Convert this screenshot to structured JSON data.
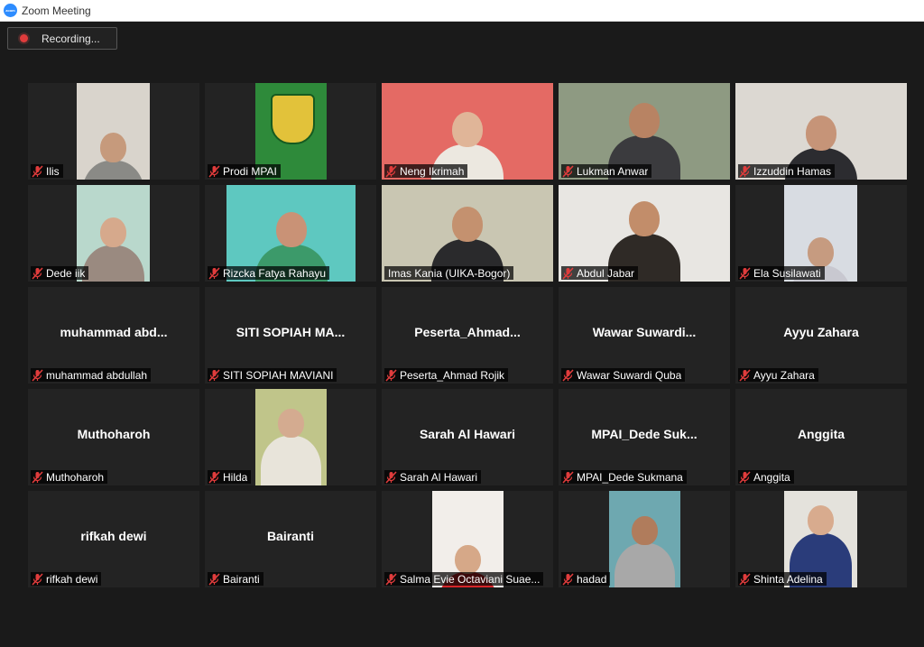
{
  "window": {
    "title": "Zoom Meeting"
  },
  "recording": {
    "label": "Recording..."
  },
  "colors": {
    "accent": "#2d8cff",
    "active_speaker": "#d8e24a",
    "muted": "#e03c3c"
  },
  "participants": [
    {
      "name": "Ilis",
      "muted": true,
      "video": true
    },
    {
      "name": "Prodi MPAI",
      "muted": true,
      "video": true
    },
    {
      "name": "Neng Ikrimah",
      "muted": true,
      "video": true
    },
    {
      "name": "Lukman Anwar",
      "muted": true,
      "video": true
    },
    {
      "name": "Izzuddin Hamas",
      "muted": true,
      "video": true
    },
    {
      "name": "Dede iik",
      "muted": true,
      "video": true
    },
    {
      "name": "Rizcka Fatya Rahayu",
      "muted": true,
      "video": true
    },
    {
      "name": "Imas Kania (UIKA-Bogor)",
      "muted": false,
      "video": true,
      "active_speaker": true
    },
    {
      "name": "Abdul Jabar",
      "muted": true,
      "video": true
    },
    {
      "name": "Ela Susilawati",
      "muted": true,
      "video": true
    },
    {
      "name": "muhammad abdullah",
      "display": "muhammad  abd...",
      "muted": true,
      "video": false
    },
    {
      "name": "SITI SOPIAH MAVIANI",
      "display": "SITI  SOPIAH  MA...",
      "muted": true,
      "video": false
    },
    {
      "name": "Peserta_Ahmad Rojik",
      "display": "Peserta_Ahmad...",
      "muted": true,
      "video": false
    },
    {
      "name": "Wawar Suwardi Quba",
      "display": "Wawar  Suwardi...",
      "muted": true,
      "video": false
    },
    {
      "name": "Ayyu Zahara",
      "display": "Ayyu Zahara",
      "muted": true,
      "video": false
    },
    {
      "name": "Muthoharoh",
      "display": "Muthoharoh",
      "muted": true,
      "video": false
    },
    {
      "name": "Hilda",
      "muted": true,
      "video": true
    },
    {
      "name": "Sarah Al Hawari",
      "display": "Sarah Al Hawari",
      "muted": true,
      "video": false
    },
    {
      "name": "MPAI_Dede Sukmana",
      "display": "MPAI_Dede  Suk...",
      "muted": true,
      "video": false
    },
    {
      "name": "Anggita",
      "display": "Anggita",
      "muted": true,
      "video": false
    },
    {
      "name": "rifkah dewi",
      "display": "rifkah dewi",
      "muted": true,
      "video": false
    },
    {
      "name": "Bairanti",
      "display": "Bairanti",
      "muted": true,
      "video": false
    },
    {
      "name": "Salma Evie Octaviani Suae...",
      "muted": true,
      "video": true
    },
    {
      "name": "hadad",
      "muted": true,
      "video": true
    },
    {
      "name": "Shinta Adelina",
      "muted": true,
      "video": true
    }
  ]
}
